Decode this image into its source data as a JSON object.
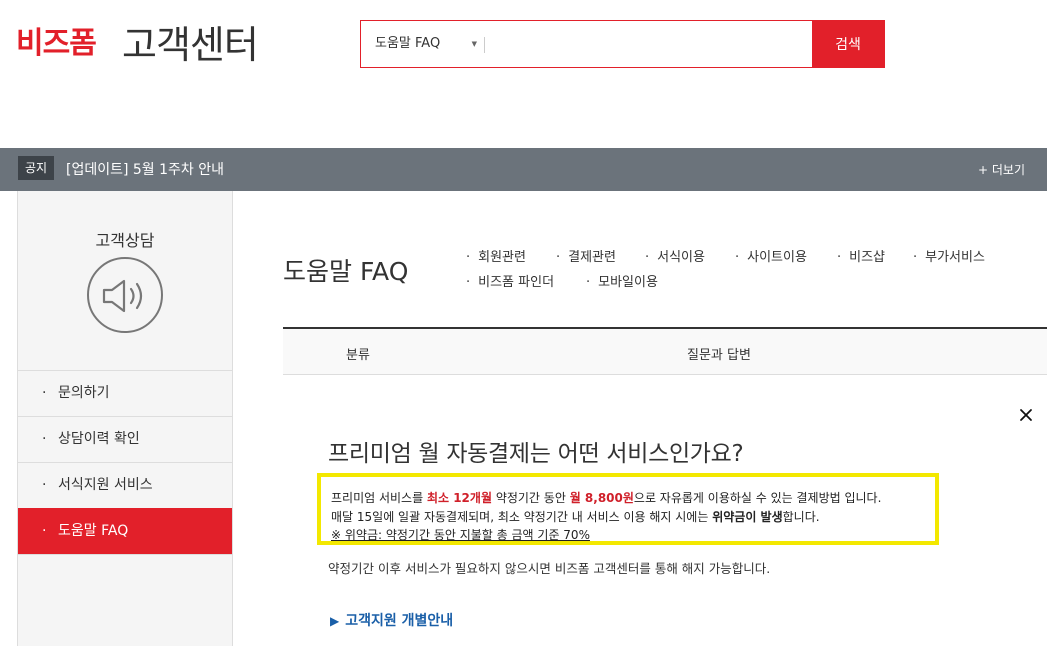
{
  "header": {
    "brand": "비즈폼",
    "title": "고객센터",
    "search": {
      "category": "도움말 FAQ",
      "value": "",
      "button_label": "검색"
    }
  },
  "notice": {
    "label": "공지",
    "text": "[업데이트] 5월 1주차 안내",
    "more_label": "+ 더보기"
  },
  "sidebar": {
    "title": "고객상담",
    "icon": "speaker-icon",
    "items": [
      {
        "label": "문의하기",
        "active": false
      },
      {
        "label": "상담이력 확인",
        "active": false
      },
      {
        "label": "서식지원 서비스",
        "active": false
      },
      {
        "label": "도움말 FAQ",
        "active": true
      }
    ]
  },
  "main": {
    "title": "도움말 FAQ",
    "categories": [
      "회원관련",
      "결제관련",
      "서식이용",
      "사이트이용",
      "비즈샵",
      "부가서비스",
      "비즈폼 파인더",
      "모바일이용"
    ],
    "table_headers": {
      "category": "분류",
      "qa": "질문과 답변"
    },
    "faq": {
      "question": "프리미엄 월 자동결제는 어떤 서비스인가요?",
      "answer": {
        "line1": {
          "p1": "프리미엄 서비스를 ",
          "h1": "최소 12개월",
          "p2": " 약정기간 동안 ",
          "h2": "월 8,800원",
          "p3": "으로 자유롭게 이용하실 수 있는 결제방법 입니다."
        },
        "line2": {
          "p1": "매달 15일에 일괄 자동결제되며, 최소 약정기간 내 서비스 이용 해지 시에는 ",
          "b1": "위약금이 발생",
          "p2": "합니다."
        },
        "line3": "※ 위약금: 약정기간 동안 지불할 총 금액 기준 70%"
      },
      "extra": "약정기간 이후 서비스가 필요하지 않으시면 비즈폼 고객센터를 통해 해지 가능합니다.",
      "link": "고객지원 개별안내"
    }
  },
  "colors": {
    "brand_red": "#e2202a",
    "notice_bar": "#6b737b",
    "highlight": "#f3e800",
    "link_blue": "#1a5fa8"
  }
}
